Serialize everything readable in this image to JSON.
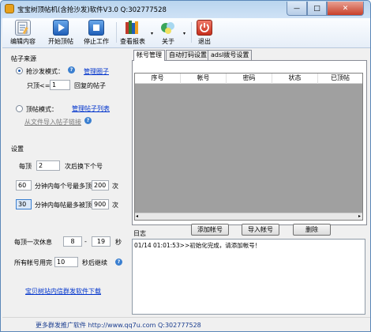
{
  "window": {
    "title": "宝宝树顶帖机(含抢沙发)软件V3.0 Q:302777528",
    "controls": {
      "minimize": "—",
      "maximize": "□",
      "close": "✕"
    }
  },
  "toolbar": {
    "items": [
      {
        "label": "编辑内容",
        "icon": "notepad-icon"
      },
      {
        "label": "开始顶帖",
        "icon": "play-icon"
      },
      {
        "label": "停止工作",
        "icon": "stop-icon"
      },
      {
        "label": "查看报表",
        "icon": "books-icon"
      },
      {
        "label": "关于",
        "icon": "about-icon"
      },
      {
        "label": "退出",
        "icon": "power-icon"
      }
    ],
    "caret": "▾"
  },
  "left": {
    "source_section": "帖子来源",
    "mode_grab": "抢沙发模式：",
    "manage_circle": "管理圈子",
    "reply_only_prefix": "只顶<=",
    "reply_only_value": "1",
    "reply_only_suffix": "回复的帖子",
    "mode_pin": "顶帖模式：",
    "manage_post_list": "管理帖子列表",
    "import_link": "从文件导入帖子链接",
    "settings_section": "设置",
    "per_prefix": "每顶",
    "per_value": "2",
    "per_suffix": "次后换下个号",
    "row2_minutes": "60",
    "row2_text": "分钟内每个号最多顶",
    "row2_max": "200",
    "row2_unit": "次",
    "row3_minutes": "30",
    "row3_text": "分钟内每帖最多被顶",
    "row3_max": "900",
    "row3_unit": "次",
    "rest_label": "每顶一次休息",
    "rest_min": "8",
    "rest_dash": "-",
    "rest_max": "19",
    "rest_unit": "秒",
    "all_used_label": "所有帐号用完",
    "all_used_value": "10",
    "all_used_suffix": "秒后继续",
    "promo_link": "宝贝树站内信群发软件下载",
    "help_glyph": "?"
  },
  "tabs": {
    "items": [
      "帐号管理",
      "自动打码设置",
      "adsl拨号设置"
    ],
    "columns": [
      "序号",
      "帐号",
      "密码",
      "状态",
      "已顶帖"
    ],
    "add_account": "添加帐号",
    "import_account": "导入帐号",
    "delete": "删除"
  },
  "log": {
    "title": "日志",
    "lines": [
      "01/14 01:01:53>>初始化完成，请添加帐号！"
    ]
  },
  "status": {
    "text": "更多群发推广软件 http://www.qq7u.com Q:302777528"
  },
  "colors": {
    "accent": "#3a7fd0",
    "link": "#0033cc",
    "grid_bg": "#a0a0a0"
  }
}
